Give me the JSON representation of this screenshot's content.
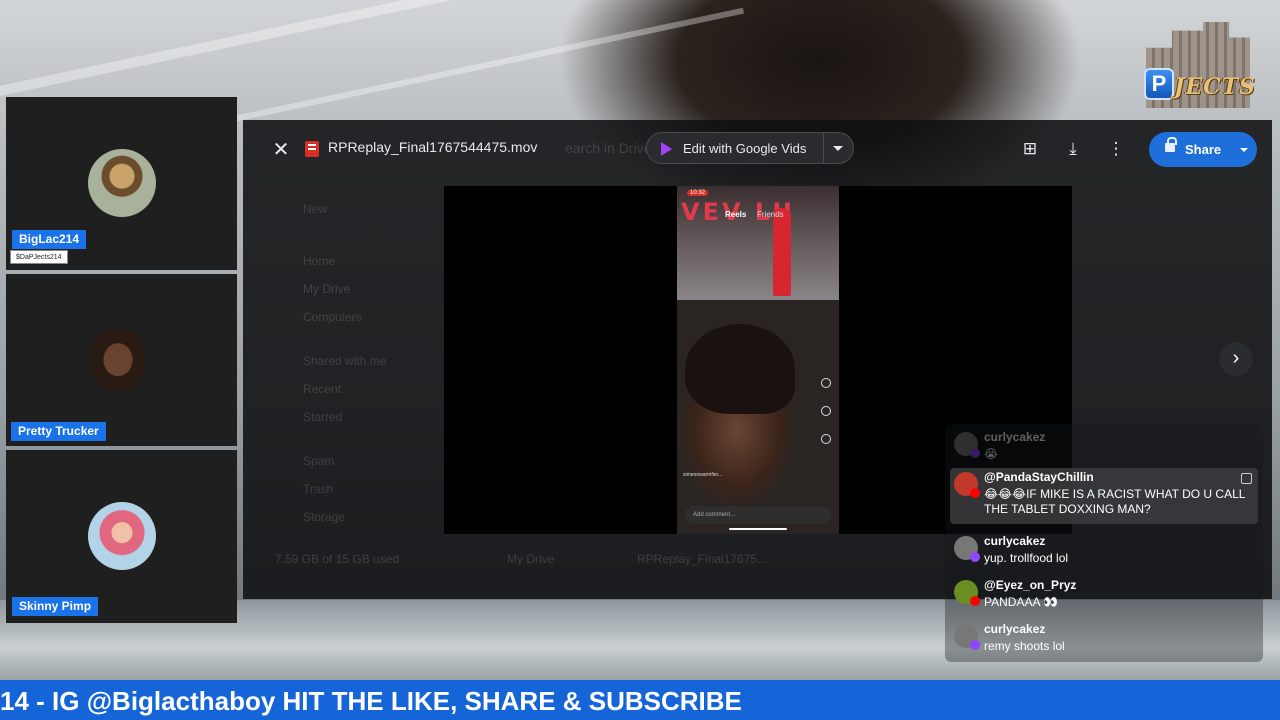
{
  "participants": [
    {
      "name": "BigLac214",
      "handle": "$DaPJects214"
    },
    {
      "name": "Pretty Trucker"
    },
    {
      "name": "Skinny Pimp"
    }
  ],
  "logo": {
    "letter": "P",
    "text": "JECTS"
  },
  "drive": {
    "file_name": "RPReplay_Final1767544475.mov",
    "edit_label": "Edit with Google Vids",
    "share_label": "Share",
    "ghost": {
      "search": "earch in Drive",
      "new": "New",
      "home": "Home",
      "my_drive": "My Drive",
      "computers": "Computers",
      "shared": "Shared with me",
      "recent": "Recent",
      "starred": "Starred",
      "spam": "Spam",
      "trash": "Trash",
      "storage": "Storage",
      "storage_used": "7.59 GB of 15 GB used",
      "breadcrumb_root": "My Drive",
      "breadcrumb_file": "RPReplay_Final17675..."
    },
    "video": {
      "time": "10:32",
      "tabs": [
        "Reels",
        "Friends"
      ],
      "sign_letters": "VEV LU",
      "comment_placeholder": "Add comment...",
      "caption": "simeonwarmfier..."
    }
  },
  "chat": [
    {
      "author": "curlycakez",
      "text": "😭",
      "platform": "twitch",
      "faded": true
    },
    {
      "author": "@PandaStayChillin",
      "text": "😂😂😂IF MIKE IS A RACIST WHAT DO U CALL THE TABLET DOXXING MAN?",
      "platform": "youtube",
      "highlight": true
    },
    {
      "author": "curlycakez",
      "text": "yup. trollfood lol",
      "platform": "twitch"
    },
    {
      "author": "@Eyez_on_Pryz",
      "text": "PANDAAA 👀",
      "platform": "youtube"
    },
    {
      "author": "curlycakez",
      "text": "remy shoots lol",
      "platform": "twitch"
    }
  ],
  "ticker": {
    "text": "14 - IG @Biglacthaboy HIT THE LIKE, SHARE & SUBSCRIBE"
  },
  "colors": {
    "accent": "#1a73e8",
    "ticker": "#1565d8",
    "twitch": "#9146ff",
    "youtube": "#ff0000"
  }
}
